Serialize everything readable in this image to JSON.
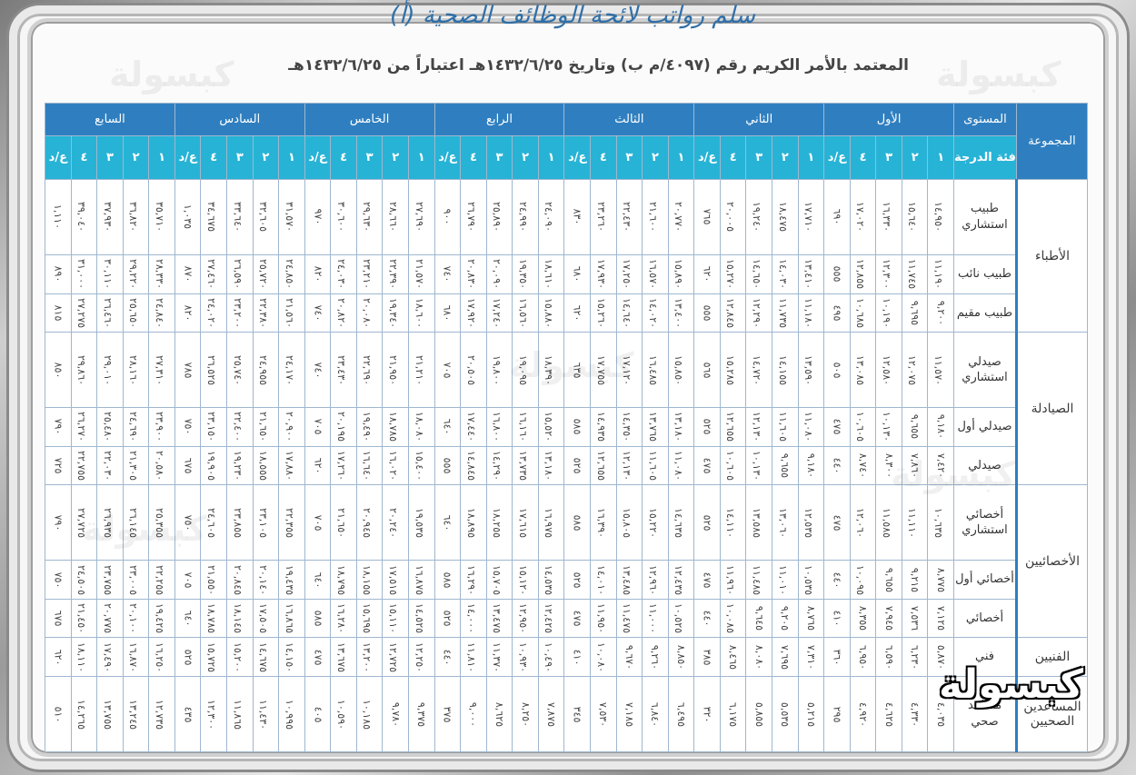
{
  "title": "سلم رواتب لائحة الوظائف الصحية (أ)",
  "subtitle": "المعتمد بالأمر الكريم رقم (٤٠٩٧/م ب) وتاريخ ١٤٣٢/٦/٢٥هـ اعتباراً من ١٤٣٢/٦/٢٥هـ",
  "header": {
    "group_label": "المجموعة",
    "level_label": "المستوى",
    "grade_label": "فئة الدرجة",
    "levels": [
      "الأول",
      "الثاني",
      "الثالث",
      "الرابع",
      "الخامس",
      "السادس",
      "السابع"
    ],
    "sub": [
      "١",
      "٢",
      "٣",
      "٤",
      "ع/د"
    ]
  },
  "groups": [
    {
      "name": "الأطباء",
      "rows": [
        {
          "cat": "طبيب استشاري",
          "vals": [
            "١٤,٩٥٠",
            "١٥,٦٤٠",
            "١٦,٣٣٠",
            "١٧,٠٢٠",
            "٦٩٠",
            "١٧,٧١٠",
            "١٨,٤٧٥",
            "١٩,٢٤٠",
            "٢٠,٠٠٥",
            "٧٦٥",
            "٢٠,٧٧٠",
            "٢١,٦٠٠",
            "٢٢,٤٣٠",
            "٢٣,٢٦٠",
            "٨٣٠",
            "٢٤,٠٩٠",
            "٢٤,٩٩٠",
            "٢٥,٨٩٠",
            "٢٦,٧٩٠",
            "٩٠٠",
            "٢٧,٦٩٠",
            "٢٨,٦٦٠",
            "٢٩,٦٣٠",
            "٣٠,٦٠٠",
            "٩٧٠",
            "٣١,٥٧٠",
            "٣٢,٦٠٥",
            "٣٣,٦٤٠",
            "٣٤,٦٧٥",
            "١,٠٣٥",
            "٣٥,٧١٠",
            "٣٦,٨٢٠",
            "٣٧,٩٣٠",
            "٣٩,٠٤٠",
            "١,١١٠"
          ]
        },
        {
          "cat": "طبيب نائب",
          "vals": [
            "١١,١٩٠",
            "١١,٧٤٥",
            "١٢,٣٠٠",
            "١٢,٨٥٥",
            "٥٥٥",
            "١٣,٤١٠",
            "١٤,٠٣٠",
            "١٤,٦٥٠",
            "١٥,٢٧٠",
            "٦٢٠",
            "١٥,٨٩٠",
            "١٦,٥٧٠",
            "١٧,٢٥٠",
            "١٧,٩٣٠",
            "٦٨٠",
            "١٨,٦١٠",
            "١٩,٣٥٠",
            "٢٠,٠٩٠",
            "٢٠,٨٣٠",
            "٧٤٠",
            "٢١,٥٧٠",
            "٢٢,٣٩٠",
            "٢٣,٢١٠",
            "٢٤,٠٣٠",
            "٨٢٠",
            "٢٤,٨٥٠",
            "٢٥,٧٢٠",
            "٢٦,٥٩٠",
            "٢٧,٤٦٠",
            "٨٧٠",
            "٢٨,٣٣٠",
            "٢٩,٢٢٠",
            "٣٠,١١٠",
            "٣١,٠٠٠",
            "٨٩٠"
          ]
        },
        {
          "cat": "طبيب مقيم",
          "vals": [
            "٩,٢٠٠",
            "٩,٦٩٥",
            "١٠,١٩٠",
            "١٠,٦٨٥",
            "٤٩٥",
            "١١,١٨٠",
            "١١,٧٣٥",
            "١٢,٢٩٠",
            "١٢,٨٤٥",
            "٥٥٥",
            "١٣,٤٠٠",
            "١٤,٠٢٠",
            "١٤,٦٤٠",
            "١٥,٢٦٠",
            "٦٢٠",
            "١٥,٨٨٠",
            "١٦,٥٦٠",
            "١٧,٢٤٠",
            "١٧,٩٢٠",
            "٦٨٠",
            "١٨,٦٠٠",
            "١٩,٣٤٠",
            "٢٠,٠٨٠",
            "٢٠,٨٢٠",
            "٧٤٠",
            "٢١,٥٦٠",
            "٢٢,٣٨٠",
            "٢٣,٢٠٠",
            "٢٤,٠٢٠",
            "٨٢٠",
            "٢٤,٨٤٠",
            "٢٥,٦٥٠",
            "٢٦,٤٦٠",
            "٢٧,٢٧٥",
            "٨١٥"
          ]
        }
      ]
    },
    {
      "name": "الصيادلة",
      "rows": [
        {
          "cat": "صيدلي استشاري",
          "vals": [
            "١١,٥٧٠",
            "١٢,٠٧٥",
            "١٢,٥٨٠",
            "١٣,٠٨٥",
            "٥٠٥",
            "١٣,٥٩٠",
            "١٤,١٥٥",
            "١٤,٧٢٠",
            "١٥,٢٨٥",
            "٥٦٥",
            "١٥,٨٥٠",
            "١٦,٤٨٥",
            "١٧,١٢٠",
            "١٧,٧٥٥",
            "٦٣٥",
            "١٨,٣٩٠",
            "١٩,٠٩٥",
            "١٩,٨٠٠",
            "٢٠,٥٠٥",
            "٧٠٥",
            "٢١,٢١٠",
            "٢١,٩٥٠",
            "٢٢,٦٩٠",
            "٢٣,٤٣٠",
            "٧٤٠",
            "٢٤,١٧٠",
            "٢٤,٩٥٥",
            "٢٥,٧٤٠",
            "٢٦,٥٢٥",
            "٧٨٥",
            "٢٧,٣١٠",
            "٢٨,١٦٠",
            "٢٩,٠١٠",
            "٢٩,٨٦٠",
            "٨٥٠"
          ]
        },
        {
          "cat": "صيدلي أول",
          "vals": [
            "٩,١٨٠",
            "٩,٦٥٥",
            "١٠,١٣٠",
            "١٠,٦٠٥",
            "٤٧٥",
            "١١,٠٨٠",
            "١١,٦٠٥",
            "١٢,١٣٠",
            "١٢,٦٥٥",
            "٥٢٥",
            "١٣,١٨٠",
            "١٣,٧٦٥",
            "١٤,٣٥٠",
            "١٤,٩٣٥",
            "٥٨٥",
            "١٥,٥٢٠",
            "١٦,١٦٠",
            "١٦,٨٠٠",
            "١٧,٤٤٠",
            "٦٤٠",
            "١٨,٠٨٠",
            "١٨,٧٨٥",
            "١٩,٤٩٠",
            "٢٠,١٩٥",
            "٧٠٥",
            "٢٠,٩٠٠",
            "٢١,٦٥٠",
            "٢٢,٤٠٠",
            "٢٣,١٥٠",
            "٧٥٠",
            "٢٣,٩٠٠",
            "٢٤,٦٩٠",
            "٢٥,٤٨٠",
            "٢٦,٢٧٠",
            "٧٩٠"
          ]
        },
        {
          "cat": "صيدلي",
          "vals": [
            "٧,٤٢٠",
            "٧,٨٦٠",
            "٨,٣٠٠",
            "٨,٧٤٠",
            "٤٤٠",
            "٩,١٨٠",
            "٩,٦٥٥",
            "١٠,١٣٠",
            "١٠,٦٠٥",
            "٤٧٥",
            "١١,٠٨٠",
            "١١,٦٠٥",
            "١٢,١٣٠",
            "١٢,٦٥٥",
            "٥٢٥",
            "١٣,١٨٠",
            "١٣,٧٣٥",
            "١٤,٢٩٠",
            "١٤,٨٤٥",
            "٥٥٥",
            "١٥,٤٠٠",
            "١٦,٠٢٠",
            "١٦,٦٤٠",
            "١٧,٢٦٠",
            "٦٢٠",
            "١٧,٨٨٠",
            "١٨,٥٥٥",
            "١٩,٢٣٠",
            "١٩,٩٠٥",
            "٦٧٥",
            "٢٠,٥٨٠",
            "٢١,٣٠٥",
            "٢٢,٠٣٠",
            "٢٢,٧٥٥",
            "٧٢٥"
          ]
        }
      ]
    },
    {
      "name": "الأخصائيين",
      "rows": [
        {
          "cat": "أخصائي استشاري",
          "vals": [
            "١٠,٦٣٥",
            "١١,١١٠",
            "١١,٥٨٥",
            "١٢,٠٦٠",
            "٤٧٥",
            "١٢,٥٣٥",
            "١٣,٠٦٠",
            "١٣,٥٨٥",
            "١٤,١١٠",
            "٥٢٥",
            "١٤,٦٣٥",
            "١٥,٢٢٠",
            "١٥,٨٠٥",
            "١٦,٣٩٠",
            "٥٨٥",
            "١٦,٩٧٥",
            "١٧,٦١٥",
            "١٨,٢٥٥",
            "١٨,٨٩٥",
            "٦٤٠",
            "١٩,٥٣٥",
            "٢٠,٢٤٠",
            "٢٠,٩٤٥",
            "٢١,٦٥٠",
            "٧٠٥",
            "٢٢,٣٥٥",
            "٢٣,١٠٥",
            "٢٣,٨٥٥",
            "٢٤,٦٠٥",
            "٧٥٠",
            "٢٥,٣٥٥",
            "٢٦,١٤٥",
            "٢٦,٩٣٥",
            "٢٧,٧٢٥",
            "٧٩٠"
          ]
        },
        {
          "cat": "أخصائي أول",
          "vals": [
            "٨,٧٧٥",
            "٩,٢١٥",
            "٩,٦٥٥",
            "١٠,٠٩٥",
            "٤٤٠",
            "١٠,٥٣٥",
            "١١,٠١٠",
            "١١,٤٨٥",
            "١١,٩٦٠",
            "٤٧٥",
            "١٢,٤٣٥",
            "١٢,٩٦٠",
            "١٣,٤٨٥",
            "١٤,٠١٠",
            "٥٢٥",
            "١٤,٥٣٥",
            "١٥,١٢٠",
            "١٥,٧٠٥",
            "١٦,٢٩٠",
            "٥٨٥",
            "١٦,٨٧٥",
            "١٧,٥١٥",
            "١٨,١٥٥",
            "١٨,٧٩٥",
            "٦٤٠",
            "١٩,٤٣٥",
            "٢٠,١٤٠",
            "٢٠,٨٤٥",
            "٢١,٥٥٠",
            "٧٠٥",
            "٢٢,٢٥٥",
            "٢٣,٠٠٥",
            "٢٣,٧٥٥",
            "٢٤,٥٠٥",
            "٧٥٠"
          ]
        },
        {
          "cat": "أخصائي",
          "vals": [
            "٧,١٢٥",
            "٧,٥٣٦",
            "٧,٩٤٥",
            "٨,٣٥٥",
            "٤١٠",
            "٨,٧٦٥",
            "٩,٢٠٥",
            "٩,٦٤٥",
            "١٠,٠٨٥",
            "٤٤٠",
            "١٠,٥٢٥",
            "١١,٠٠٠",
            "١١,٤٧٥",
            "١١,٩٥٠",
            "٤٧٥",
            "١٢,٤٢٥",
            "١٢,٩٥٠",
            "١٣,٤٧٥",
            "١٤,٠٠٠",
            "٥٢٥",
            "١٤,٥٢٥",
            "١٥,١١٠",
            "١٥,٦٩٥",
            "١٦,٢٨٠",
            "٥٨٥",
            "١٦,٨٦٥",
            "١٧,٥٠٥",
            "١٨,١٤٥",
            "١٨,٧٨٥",
            "٦٤٠",
            "١٩,٤٢٥",
            "٢٠,١٠٠",
            "٢٠,٧٧٥",
            "٢١,٤٥٠",
            "٦٧٥"
          ]
        }
      ]
    },
    {
      "name": "الفنيين",
      "rows": [
        {
          "cat": "فني",
          "vals": [
            "٥,٨٧٠",
            "٦,٢٣٠",
            "٦,٥٩٠",
            "٦,٩٥٠",
            "٣٦٠",
            "٧,٣١٠",
            "٧,٦٩٥",
            "٨,٠٨٠",
            "٨,٤٦٥",
            "٣٨٥",
            "٨,٨٥٠",
            "٩,٢٦٠",
            "٩,٦٧٠",
            "١٠,٠٨٠",
            "٤١٠",
            "١٠,٤٩٠",
            "١٠,٩٣٠",
            "١١,٣٧٠",
            "١١,٨١٠",
            "٤٤٠",
            "١٢,٢٥٠",
            "١٢,٧٢٥",
            "١٣,٢٠٠",
            "١٣,٦٧٥",
            "٤٧٥",
            "١٤,١٥٠",
            "١٤,٦٧٥",
            "١٥,٢٠٠",
            "١٥,٧٢٥",
            "٥٢٥",
            "١٦,٢٥٠",
            "١٦,٨٧٠",
            "١٧,٤٩٠",
            "١٨,١١٠",
            "٦٢٠"
          ]
        }
      ]
    },
    {
      "name": "المساعدين الصحيين",
      "rows": [
        {
          "cat": "مساعد صحي",
          "vals": [
            "٤,٠٣٥",
            "٤,٣٣٠",
            "٤,٦٢٥",
            "٤,٩٢٠",
            "٢٩٥",
            "٥,٢١٥",
            "٥,٥٣٥",
            "٥,٨٥٥",
            "٦,١٧٥",
            "٣٢٠",
            "٦,٤٩٥",
            "٦,٨٤٠",
            "٧,١٨٥",
            "٧,٥٣٠",
            "٣٤٥",
            "٧,٨٧٥",
            "٨,٢٥٠",
            "٨,٦٢٥",
            "٩,٠٠٠",
            "٣٧٥",
            "٩,٣٧٥",
            "٩,٧٨٠",
            "١٠,١٨٥",
            "١٠,٥٩٠",
            "٤٠٥",
            "١٠,٩٩٥",
            "١١,٤٣٠",
            "١١,٨٦٥",
            "١٢,٣٠٠",
            "٤٣٥",
            "١٢,٧٣٥",
            "١٣,٢٤٥",
            "١٣,٧٥٥",
            "١٤,٢٦٥",
            "٥١٠"
          ]
        }
      ]
    }
  ],
  "logo_text": "كبسولة",
  "watermark_text": "كبسولة",
  "colors": {
    "header": "#2f7fc0",
    "subheader": "#27b3d6",
    "title": "#2f6fa8"
  }
}
